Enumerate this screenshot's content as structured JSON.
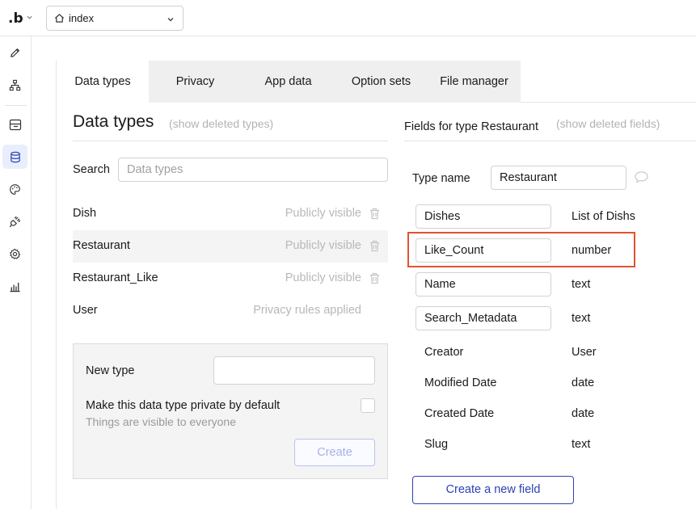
{
  "topbar": {
    "logo": ".b",
    "page_select": "index"
  },
  "tabs": [
    {
      "label": "Data types"
    },
    {
      "label": "Privacy"
    },
    {
      "label": "App data"
    },
    {
      "label": "Option sets"
    },
    {
      "label": "File manager"
    }
  ],
  "left": {
    "title": "Data types",
    "show_deleted": "(show deleted types)",
    "search_label": "Search",
    "search_placeholder": "Data types",
    "types": [
      {
        "name": "Dish",
        "status": "Publicly visible"
      },
      {
        "name": "Restaurant",
        "status": "Publicly visible"
      },
      {
        "name": "Restaurant_Like",
        "status": "Publicly visible"
      },
      {
        "name": "User",
        "status": "Privacy rules applied"
      }
    ],
    "new_type_label": "New type",
    "new_type_value": "",
    "private_label": "Make this data type private by default",
    "private_hint": "Things are visible to everyone",
    "create_label": "Create"
  },
  "right": {
    "title": "Fields for type Restaurant",
    "show_deleted": "(show deleted fields)",
    "type_name_label": "Type name",
    "type_name_value": "Restaurant",
    "editable_fields": [
      {
        "name": "Dishes",
        "type": "List of Dishs"
      },
      {
        "name": "Like_Count",
        "type": "number"
      },
      {
        "name": "Name",
        "type": "text"
      },
      {
        "name": "Search_Metadata",
        "type": "text"
      }
    ],
    "builtin_fields": [
      {
        "name": "Creator",
        "type": "User"
      },
      {
        "name": "Modified Date",
        "type": "date"
      },
      {
        "name": "Created Date",
        "type": "date"
      },
      {
        "name": "Slug",
        "type": "text"
      }
    ],
    "create_field_label": "Create a new field"
  },
  "colors": {
    "accent": "#2c42b5",
    "highlight_border": "#e0532f",
    "tab_bar": "#efefef",
    "muted_text": "#b8b8b8"
  },
  "icons": [
    "home-icon",
    "chevron-down-icon",
    "pencil-icon",
    "sitemap-icon",
    "layout-icon",
    "database-icon",
    "palette-icon",
    "plug-icon",
    "gear-icon",
    "chart-icon",
    "trash-icon",
    "comment-icon"
  ]
}
